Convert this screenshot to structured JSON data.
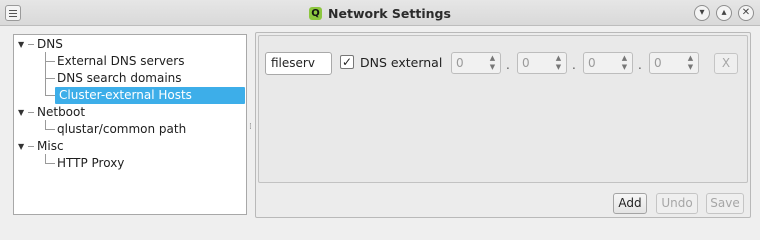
{
  "window": {
    "title": "Network Settings",
    "logo_letter": "Q"
  },
  "titlebar_buttons": {
    "minimize": "▾",
    "maximize": "▴",
    "close": "✕"
  },
  "tree": {
    "dns": "DNS",
    "dns_children": [
      "External DNS servers",
      "DNS search domains",
      "Cluster-external Hosts"
    ],
    "netboot": "Netboot",
    "netboot_children": [
      "qlustar/common path"
    ],
    "misc": "Misc",
    "misc_children": [
      "HTTP Proxy"
    ],
    "selected": "Cluster-external Hosts"
  },
  "host_entry": {
    "hostname": "fileserv",
    "dns_external_checked": true,
    "dns_external_label": "DNS external",
    "ip_octets": [
      "0",
      "0",
      "0",
      "0"
    ],
    "separator": ".",
    "remove_label": "X"
  },
  "buttons": {
    "add": "Add",
    "undo": "Undo",
    "save": "Save"
  }
}
